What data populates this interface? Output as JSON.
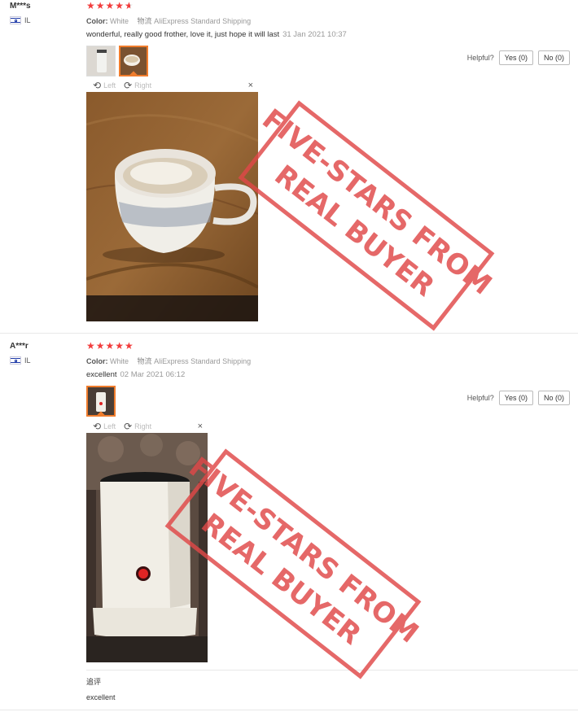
{
  "reviews": [
    {
      "user": "M***s",
      "country": "IL",
      "rating": 4.5,
      "color_label": "Color:",
      "color_value": "White",
      "shipping_label": "物流",
      "shipping_value": "AliExpress Standard Shipping",
      "text": "wonderful, really good frother, love it, just hope it will last",
      "date": "31 Jan 2021 10:37",
      "viewer": {
        "left": "Left",
        "right": "Right",
        "close": "×"
      },
      "helpful_label": "Helpful?",
      "yes_label": "Yes (0)",
      "no_label": "No (0)"
    },
    {
      "user": "A***r",
      "country": "IL",
      "rating": 5,
      "color_label": "Color:",
      "color_value": "White",
      "shipping_label": "物流",
      "shipping_value": "AliExpress Standard Shipping",
      "text": "excellent",
      "date": "02 Mar 2021 06:12",
      "viewer": {
        "left": "Left",
        "right": "Right",
        "close": "×"
      },
      "helpful_label": "Helpful?",
      "yes_label": "Yes (0)",
      "no_label": "No (0)",
      "additional_label": "追评",
      "additional_text": "excellent"
    }
  ],
  "stamp": {
    "line1": "FIVE-STARS FROM",
    "line2": "REAL BUYER",
    "color": "#e04848"
  },
  "icons": {
    "rotate_left": "rotate-left-icon",
    "rotate_right": "rotate-right-icon",
    "close": "close-icon",
    "flag": "flag-il-icon"
  }
}
